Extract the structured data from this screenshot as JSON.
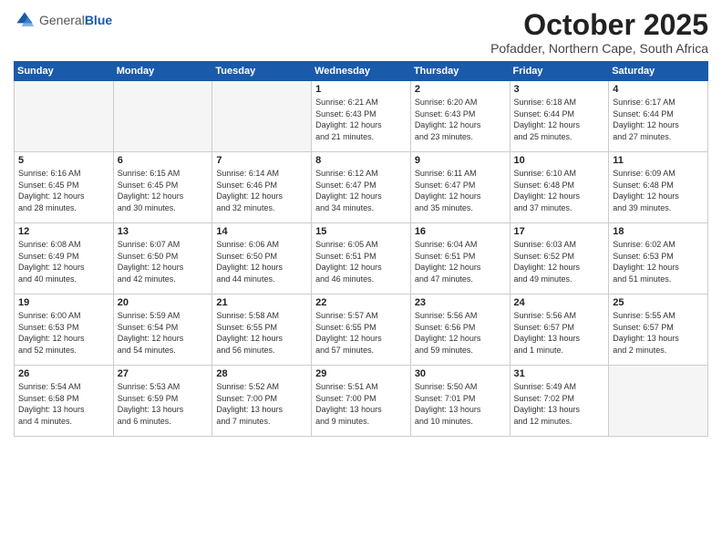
{
  "logo": {
    "general": "General",
    "blue": "Blue"
  },
  "header": {
    "month": "October 2025",
    "location": "Pofadder, Northern Cape, South Africa"
  },
  "weekdays": [
    "Sunday",
    "Monday",
    "Tuesday",
    "Wednesday",
    "Thursday",
    "Friday",
    "Saturday"
  ],
  "weeks": [
    [
      {
        "day": "",
        "info": ""
      },
      {
        "day": "",
        "info": ""
      },
      {
        "day": "",
        "info": ""
      },
      {
        "day": "1",
        "info": "Sunrise: 6:21 AM\nSunset: 6:43 PM\nDaylight: 12 hours\nand 21 minutes."
      },
      {
        "day": "2",
        "info": "Sunrise: 6:20 AM\nSunset: 6:43 PM\nDaylight: 12 hours\nand 23 minutes."
      },
      {
        "day": "3",
        "info": "Sunrise: 6:18 AM\nSunset: 6:44 PM\nDaylight: 12 hours\nand 25 minutes."
      },
      {
        "day": "4",
        "info": "Sunrise: 6:17 AM\nSunset: 6:44 PM\nDaylight: 12 hours\nand 27 minutes."
      }
    ],
    [
      {
        "day": "5",
        "info": "Sunrise: 6:16 AM\nSunset: 6:45 PM\nDaylight: 12 hours\nand 28 minutes."
      },
      {
        "day": "6",
        "info": "Sunrise: 6:15 AM\nSunset: 6:45 PM\nDaylight: 12 hours\nand 30 minutes."
      },
      {
        "day": "7",
        "info": "Sunrise: 6:14 AM\nSunset: 6:46 PM\nDaylight: 12 hours\nand 32 minutes."
      },
      {
        "day": "8",
        "info": "Sunrise: 6:12 AM\nSunset: 6:47 PM\nDaylight: 12 hours\nand 34 minutes."
      },
      {
        "day": "9",
        "info": "Sunrise: 6:11 AM\nSunset: 6:47 PM\nDaylight: 12 hours\nand 35 minutes."
      },
      {
        "day": "10",
        "info": "Sunrise: 6:10 AM\nSunset: 6:48 PM\nDaylight: 12 hours\nand 37 minutes."
      },
      {
        "day": "11",
        "info": "Sunrise: 6:09 AM\nSunset: 6:48 PM\nDaylight: 12 hours\nand 39 minutes."
      }
    ],
    [
      {
        "day": "12",
        "info": "Sunrise: 6:08 AM\nSunset: 6:49 PM\nDaylight: 12 hours\nand 40 minutes."
      },
      {
        "day": "13",
        "info": "Sunrise: 6:07 AM\nSunset: 6:50 PM\nDaylight: 12 hours\nand 42 minutes."
      },
      {
        "day": "14",
        "info": "Sunrise: 6:06 AM\nSunset: 6:50 PM\nDaylight: 12 hours\nand 44 minutes."
      },
      {
        "day": "15",
        "info": "Sunrise: 6:05 AM\nSunset: 6:51 PM\nDaylight: 12 hours\nand 46 minutes."
      },
      {
        "day": "16",
        "info": "Sunrise: 6:04 AM\nSunset: 6:51 PM\nDaylight: 12 hours\nand 47 minutes."
      },
      {
        "day": "17",
        "info": "Sunrise: 6:03 AM\nSunset: 6:52 PM\nDaylight: 12 hours\nand 49 minutes."
      },
      {
        "day": "18",
        "info": "Sunrise: 6:02 AM\nSunset: 6:53 PM\nDaylight: 12 hours\nand 51 minutes."
      }
    ],
    [
      {
        "day": "19",
        "info": "Sunrise: 6:00 AM\nSunset: 6:53 PM\nDaylight: 12 hours\nand 52 minutes."
      },
      {
        "day": "20",
        "info": "Sunrise: 5:59 AM\nSunset: 6:54 PM\nDaylight: 12 hours\nand 54 minutes."
      },
      {
        "day": "21",
        "info": "Sunrise: 5:58 AM\nSunset: 6:55 PM\nDaylight: 12 hours\nand 56 minutes."
      },
      {
        "day": "22",
        "info": "Sunrise: 5:57 AM\nSunset: 6:55 PM\nDaylight: 12 hours\nand 57 minutes."
      },
      {
        "day": "23",
        "info": "Sunrise: 5:56 AM\nSunset: 6:56 PM\nDaylight: 12 hours\nand 59 minutes."
      },
      {
        "day": "24",
        "info": "Sunrise: 5:56 AM\nSunset: 6:57 PM\nDaylight: 13 hours\nand 1 minute."
      },
      {
        "day": "25",
        "info": "Sunrise: 5:55 AM\nSunset: 6:57 PM\nDaylight: 13 hours\nand 2 minutes."
      }
    ],
    [
      {
        "day": "26",
        "info": "Sunrise: 5:54 AM\nSunset: 6:58 PM\nDaylight: 13 hours\nand 4 minutes."
      },
      {
        "day": "27",
        "info": "Sunrise: 5:53 AM\nSunset: 6:59 PM\nDaylight: 13 hours\nand 6 minutes."
      },
      {
        "day": "28",
        "info": "Sunrise: 5:52 AM\nSunset: 7:00 PM\nDaylight: 13 hours\nand 7 minutes."
      },
      {
        "day": "29",
        "info": "Sunrise: 5:51 AM\nSunset: 7:00 PM\nDaylight: 13 hours\nand 9 minutes."
      },
      {
        "day": "30",
        "info": "Sunrise: 5:50 AM\nSunset: 7:01 PM\nDaylight: 13 hours\nand 10 minutes."
      },
      {
        "day": "31",
        "info": "Sunrise: 5:49 AM\nSunset: 7:02 PM\nDaylight: 13 hours\nand 12 minutes."
      },
      {
        "day": "",
        "info": ""
      }
    ]
  ]
}
